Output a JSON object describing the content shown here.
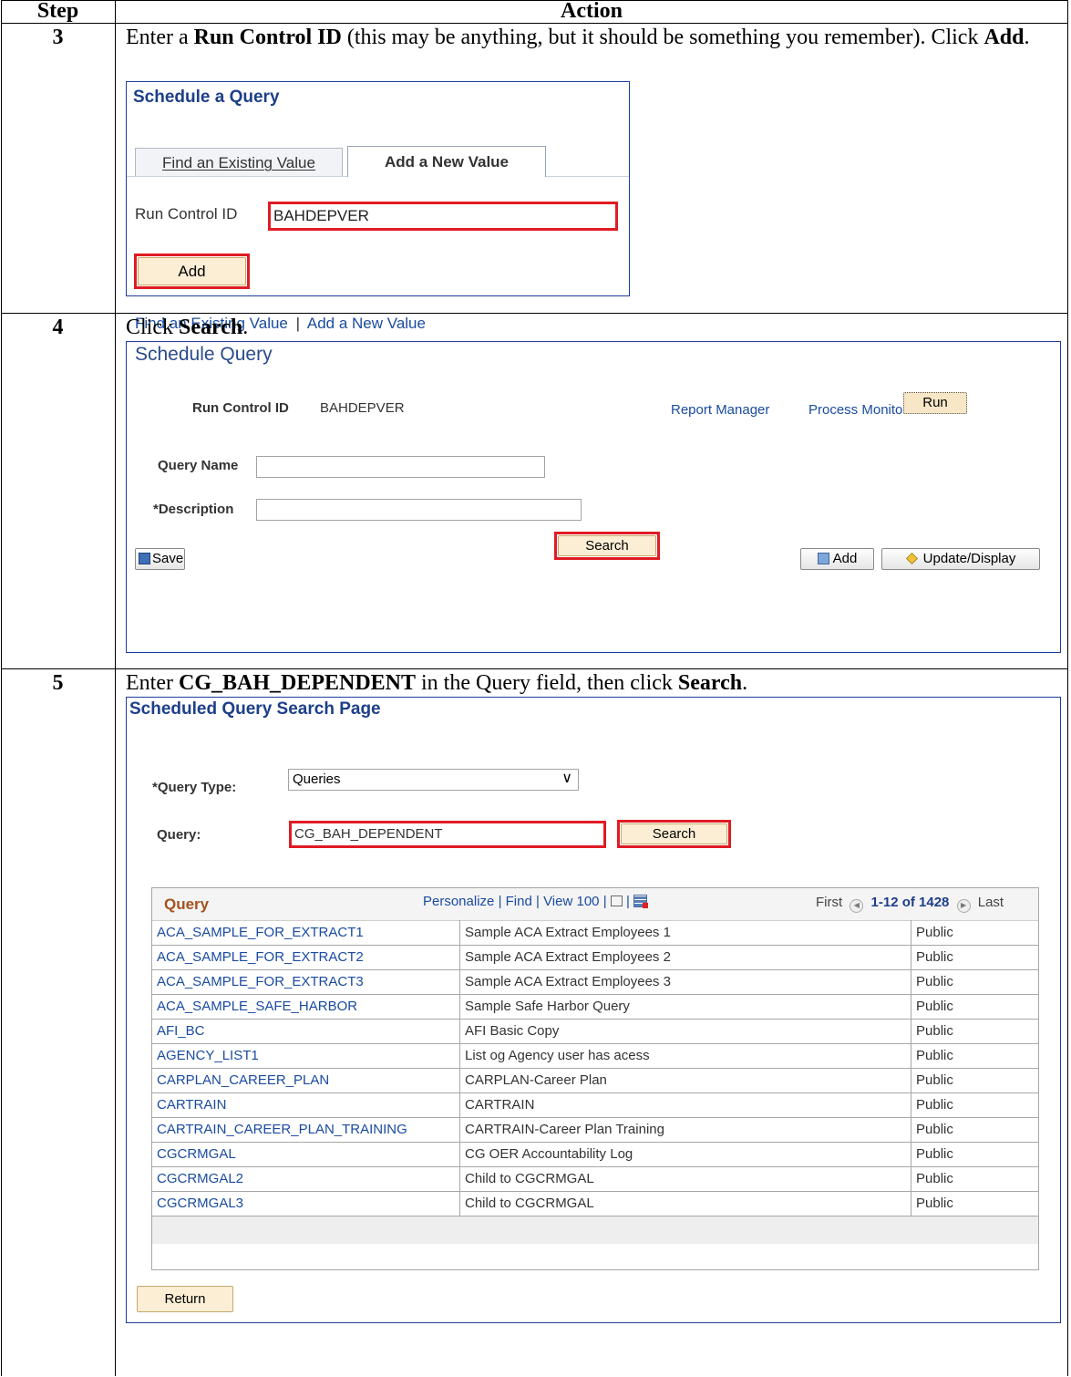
{
  "header": {
    "step_label": "Step",
    "action_label": "Action"
  },
  "step3": {
    "number": "3",
    "instruction": {
      "t1": "Enter a ",
      "b1": "Run Control ID",
      "t2": " (this may be anything, but it should be something you remember).  Click ",
      "b2": "Add",
      "t3": "."
    },
    "panel": {
      "title": "Schedule a Query",
      "tab_find": "Find an Existing Value",
      "tab_add": "Add a New Value",
      "run_control_label": "Run Control ID",
      "run_control_value": "BAHDEPVER",
      "add_button": "Add",
      "link_find": "Find an Existing Value",
      "link_separator": "|",
      "link_add": "Add a New Value"
    }
  },
  "step4": {
    "number": "4",
    "instruction": {
      "t1": "Click ",
      "b1": "Search",
      "t2": "."
    },
    "panel": {
      "title": "Schedule Query",
      "run_control_label": "Run Control ID",
      "run_control_value": "BAHDEPVER",
      "report_manager": "Report Manager",
      "process_monitor": "Process Monitor",
      "run_button": "Run",
      "query_name_label": "Query Name",
      "query_name_value": "",
      "search_button": "Search",
      "description_label": "*Description",
      "description_value": "",
      "save_button": "Save",
      "add_button": "Add",
      "update_display_button": "Update/Display"
    }
  },
  "step5": {
    "number": "5",
    "instruction": {
      "t1": "Enter ",
      "b1": "CG_BAH_DEPENDENT",
      "t2": " in the Query field, then click ",
      "b2": "Search",
      "t3": "."
    },
    "panel": {
      "title": "Scheduled Query Search Page",
      "query_type_label": "*Query Type:",
      "query_type_value": "Queries",
      "query_label": "Query:",
      "query_value": "CG_BAH_DEPENDENT",
      "search_button": "Search",
      "grid": {
        "title": "Query",
        "personalize": "Personalize",
        "find": "Find",
        "view100": "View 100",
        "first": "First",
        "range": "1-12 of 1428",
        "last": "Last",
        "rows": [
          {
            "name": "ACA_SAMPLE_FOR_EXTRACT1",
            "description": "Sample ACA Extract Employees 1",
            "access": "Public"
          },
          {
            "name": "ACA_SAMPLE_FOR_EXTRACT2",
            "description": "Sample ACA Extract Employees 2",
            "access": "Public"
          },
          {
            "name": "ACA_SAMPLE_FOR_EXTRACT3",
            "description": "Sample ACA Extract Employees 3",
            "access": "Public"
          },
          {
            "name": "ACA_SAMPLE_SAFE_HARBOR",
            "description": "Sample Safe Harbor Query",
            "access": "Public"
          },
          {
            "name": "AFI_BC",
            "description": "AFI Basic Copy",
            "access": "Public"
          },
          {
            "name": "AGENCY_LIST1",
            "description": "List og Agency user has acess",
            "access": "Public"
          },
          {
            "name": "CARPLAN_CAREER_PLAN",
            "description": "CARPLAN-Career Plan",
            "access": "Public"
          },
          {
            "name": "CARTRAIN",
            "description": "CARTRAIN",
            "access": "Public"
          },
          {
            "name": "CARTRAIN_CAREER_PLAN_TRAINING",
            "description": "CARTRAIN-Career Plan Training",
            "access": "Public"
          },
          {
            "name": "CGCRMGAL",
            "description": "CG OER Accountability Log",
            "access": "Public"
          },
          {
            "name": "CGCRMGAL2",
            "description": "Child to CGCRMGAL",
            "access": "Public"
          },
          {
            "name": "CGCRMGAL3",
            "description": "Child to CGCRMGAL",
            "access": "Public"
          }
        ]
      },
      "return_button": "Return"
    }
  },
  "colors": {
    "highlight": "#e01b24",
    "link": "#1a4ba0",
    "panel_border": "#1f3c9e",
    "grid_title": "#a6511d"
  }
}
